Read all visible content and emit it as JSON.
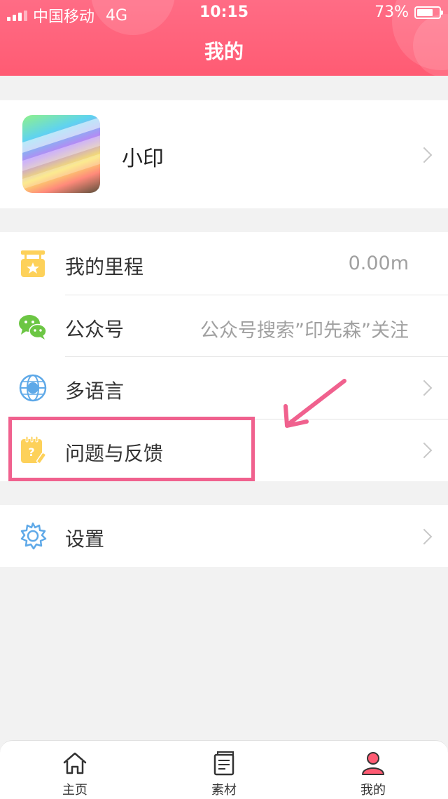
{
  "status_bar": {
    "carrier": "中国移动",
    "network": "4G",
    "time": "10:15",
    "battery": "73%",
    "battery_level": 0.73
  },
  "header": {
    "title": "我的"
  },
  "profile": {
    "name": "小印"
  },
  "menu": [
    {
      "label": "我的里程",
      "value": "0.00m",
      "icon": "ticket-star-icon"
    },
    {
      "label": "公众号",
      "value": "公众号搜索”印先森”关注",
      "icon": "wechat-icon"
    },
    {
      "label": "多语言",
      "value": "",
      "icon": "globe-language-icon"
    },
    {
      "label": "问题与反馈",
      "value": "",
      "icon": "feedback-note-icon"
    }
  ],
  "settings": {
    "label": "设置",
    "icon": "gear-icon"
  },
  "tabbar": [
    {
      "label": "主页",
      "icon": "home-icon"
    },
    {
      "label": "素材",
      "icon": "material-book-icon"
    },
    {
      "label": "我的",
      "icon": "user-icon"
    }
  ],
  "colors": {
    "brand": "#ff5b73",
    "highlight": "#f0618e",
    "icon_yellow": "#fdd15a",
    "icon_green": "#6cc644",
    "icon_blue": "#5fa9e8"
  }
}
